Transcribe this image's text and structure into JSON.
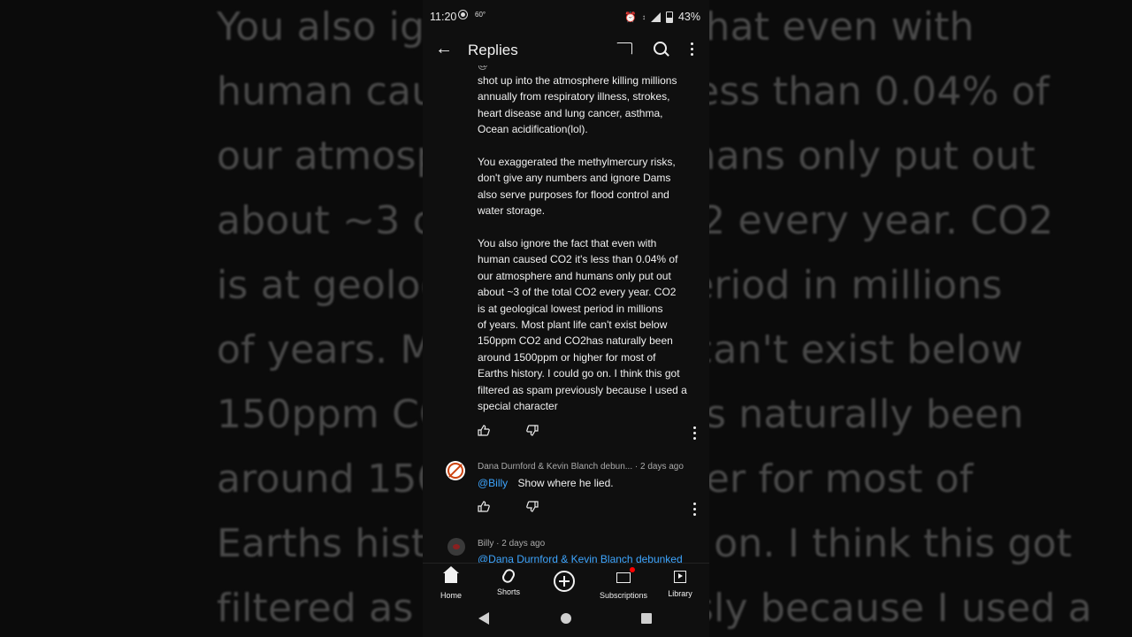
{
  "background": {
    "lines": [
      "You also ignore the fact that even with",
      "human caused CO2 it's less than 0.04% of",
      "our atmosphere and humans only put out",
      "about ~3 of the total CO2 every year.  CO2",
      "is at geological lowest period in millions",
      "of years.  Most plant life can't exist below",
      "150ppm CO2 and CO2has naturally been",
      "around 1500ppm or higher for most of",
      "Earths history.  I could go on. I think this got",
      "filtered as spam previously because I used a"
    ]
  },
  "status_bar": {
    "time": "11:20",
    "temp": "60°",
    "battery": "43%"
  },
  "app_bar": {
    "title": "Replies"
  },
  "comment": {
    "cut_author": "@",
    "paragraphs": [
      "shot up into the atmosphere killing millions\nannually from respiratory illness, strokes,\nheart disease and lung cancer, asthma,\nOcean acidification(lol).",
      "You exaggerated the methylmercury risks,\ndon't give any numbers and ignore Dams\nalso serve purposes for flood control and\nwater storage.",
      "You also ignore the fact that even with\nhuman caused CO2 it's less than 0.04% of\nour atmosphere and humans only put out\nabout ~3 of the total CO2 every year.  CO2\nis at geological lowest period in millions\nof years.  Most plant life can't exist below\n150ppm CO2 and CO2has naturally been\naround 1500ppm or higher for most of\nEarths history.  I could go on. I think this got\nfiltered as spam previously because I used a\nspecial character"
    ]
  },
  "replies": [
    {
      "author": "Dana Durnford & Kevin Blanch debun...",
      "time": "· 2 days ago",
      "mention": "@Billy",
      "text": "Show where he lied."
    },
    {
      "author": "Billy",
      "time": "· 2 days ago",
      "mention": "@Dana Durnford & Kevin Blanch debunked",
      "text": ""
    }
  ],
  "bottom_nav": {
    "home": "Home",
    "shorts": "Shorts",
    "subscriptions": "Subscriptions",
    "library": "Library"
  }
}
